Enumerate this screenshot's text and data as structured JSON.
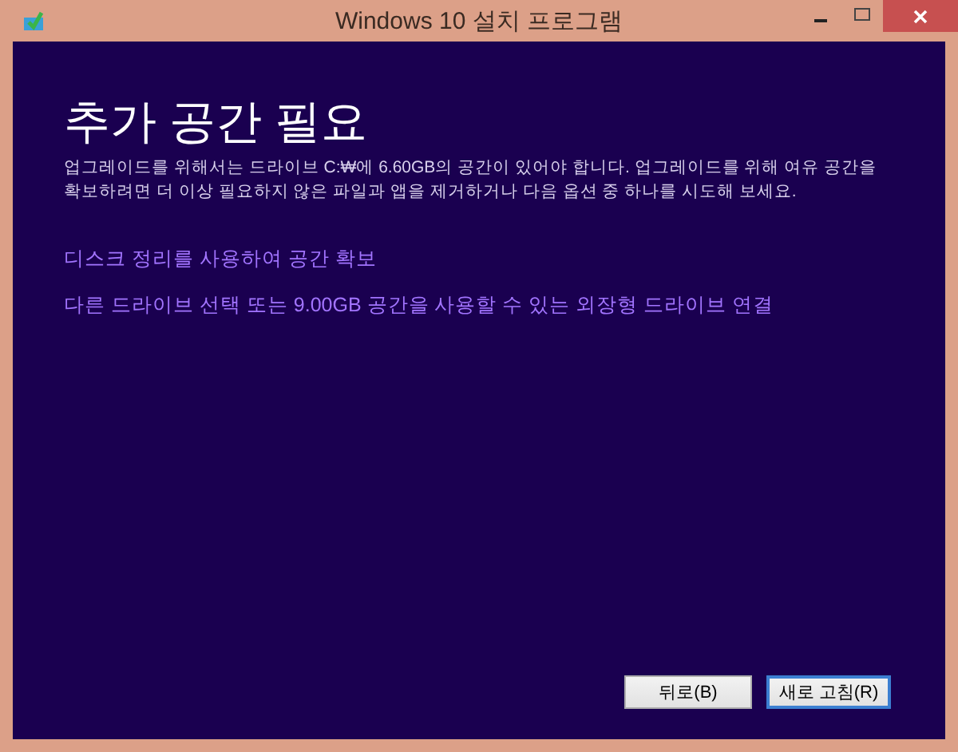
{
  "window": {
    "title": "Windows 10 설치 프로그램"
  },
  "heading": "추가 공간 필요",
  "description": "업그레이드를 위해서는 드라이브 C:₩에 6.60GB의 공간이 있어야 합니다. 업그레이드를 위해 여유 공간을 확보하려면 더 이상 필요하지 않은 파일과 앱을 제거하거나 다음 옵션 중 하나를 시도해 보세요.",
  "options": [
    {
      "label": "디스크 정리를 사용하여 공간 확보"
    },
    {
      "label": "다른 드라이브 선택 또는 9.00GB 공간을 사용할 수 있는 외장형 드라이브 연결"
    }
  ],
  "buttons": [
    {
      "label": "뒤로(B)",
      "selected": false
    },
    {
      "label": "새로 고침(R)",
      "selected": true
    }
  ]
}
